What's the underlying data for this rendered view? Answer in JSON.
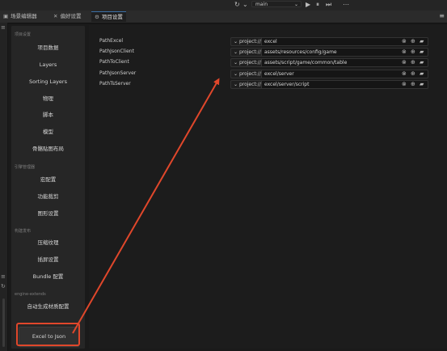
{
  "toolbar": {
    "refresh_icon": "↻",
    "chev_icon": "⌄",
    "scene_select": "main",
    "play_icon": "▶",
    "pause_icon": "⏸",
    "step_icon": "⏭",
    "more_icon": "⋯"
  },
  "tabs": [
    {
      "label": "场景编辑器",
      "icon": "▣"
    },
    {
      "label": "偏好设置",
      "icon": "✕"
    },
    {
      "label": "项目设置",
      "icon": "⚙"
    }
  ],
  "menu_icon": "≡",
  "sidebar": {
    "sections": [
      {
        "title": "项目设置",
        "items": [
          "项目数据",
          "Layers",
          "Sorting Layers",
          "物理",
          "脚本",
          "模型",
          "骨骼贴图布局"
        ]
      },
      {
        "title": "引擎管理器",
        "items": [
          "宏配置",
          "功能裁剪",
          "图形设置"
        ]
      },
      {
        "title": "构建发布",
        "items": [
          "压缩纹理",
          "插屏设置",
          "Bundle 配置"
        ]
      },
      {
        "title": "engine-extends",
        "items": [
          "自动生成材质配置"
        ]
      }
    ],
    "selected_item": "Excel to Json"
  },
  "settings": {
    "rows": [
      {
        "label": "PathExcel",
        "prefix": "project://",
        "value": "excel"
      },
      {
        "label": "PathJsonClient",
        "prefix": "project://",
        "value": "assets/resources/config/game"
      },
      {
        "label": "PathToClient",
        "prefix": "project://",
        "value": "assets/script/game/common/table"
      },
      {
        "label": "PathJsonServer",
        "prefix": "project://",
        "value": "excel/server"
      },
      {
        "label": "PathTsServer",
        "prefix": "project://",
        "value": "excel/server/script"
      }
    ],
    "chev_icon": "⌄",
    "clear_icon": "⊗",
    "search_icon": "⊕",
    "folder_icon": "▰"
  },
  "annotation": {
    "color": "#e0472b"
  }
}
